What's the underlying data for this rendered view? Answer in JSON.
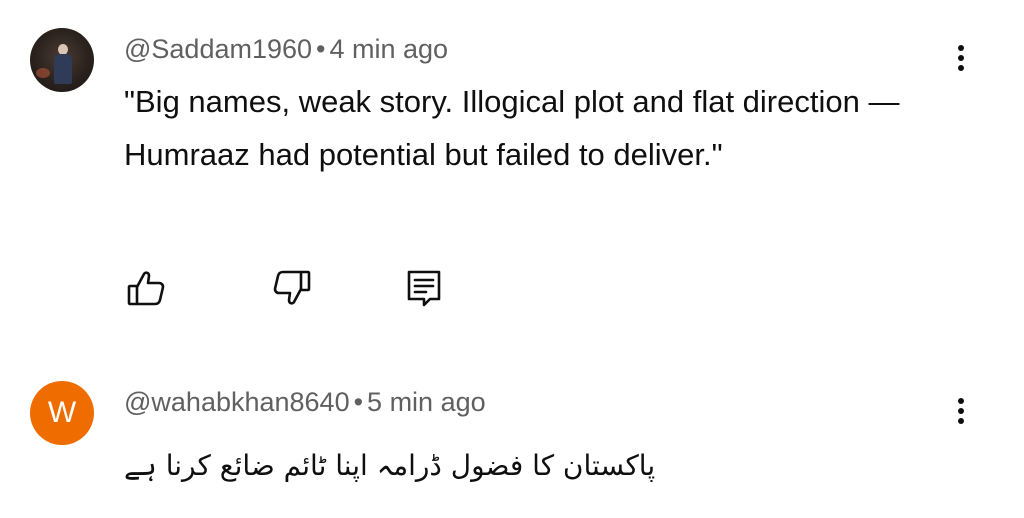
{
  "comments": [
    {
      "author": "@Saddam1960",
      "separator": "•",
      "time": "4 min ago",
      "text": "\"Big names, weak story. Illogical plot and flat direction — Humraaz had potential but failed to deliver.\"",
      "avatar_type": "photo",
      "actions": [
        "thumbs-up-icon",
        "thumbs-down-icon",
        "reply-icon"
      ]
    },
    {
      "author": "@wahabkhan8640",
      "separator": "•",
      "time": "5 min ago",
      "text": "پاکستان کا فضول ڈرامہ اپنا ٹائم ضائع کرنا ہے",
      "avatar_letter": "W",
      "avatar_color": "#ef6c00"
    }
  ],
  "more_icon": "vertical-ellipsis-icon",
  "colors": {
    "meta_text": "#606060",
    "body_text": "#0f0f0f",
    "background": "#ffffff"
  }
}
